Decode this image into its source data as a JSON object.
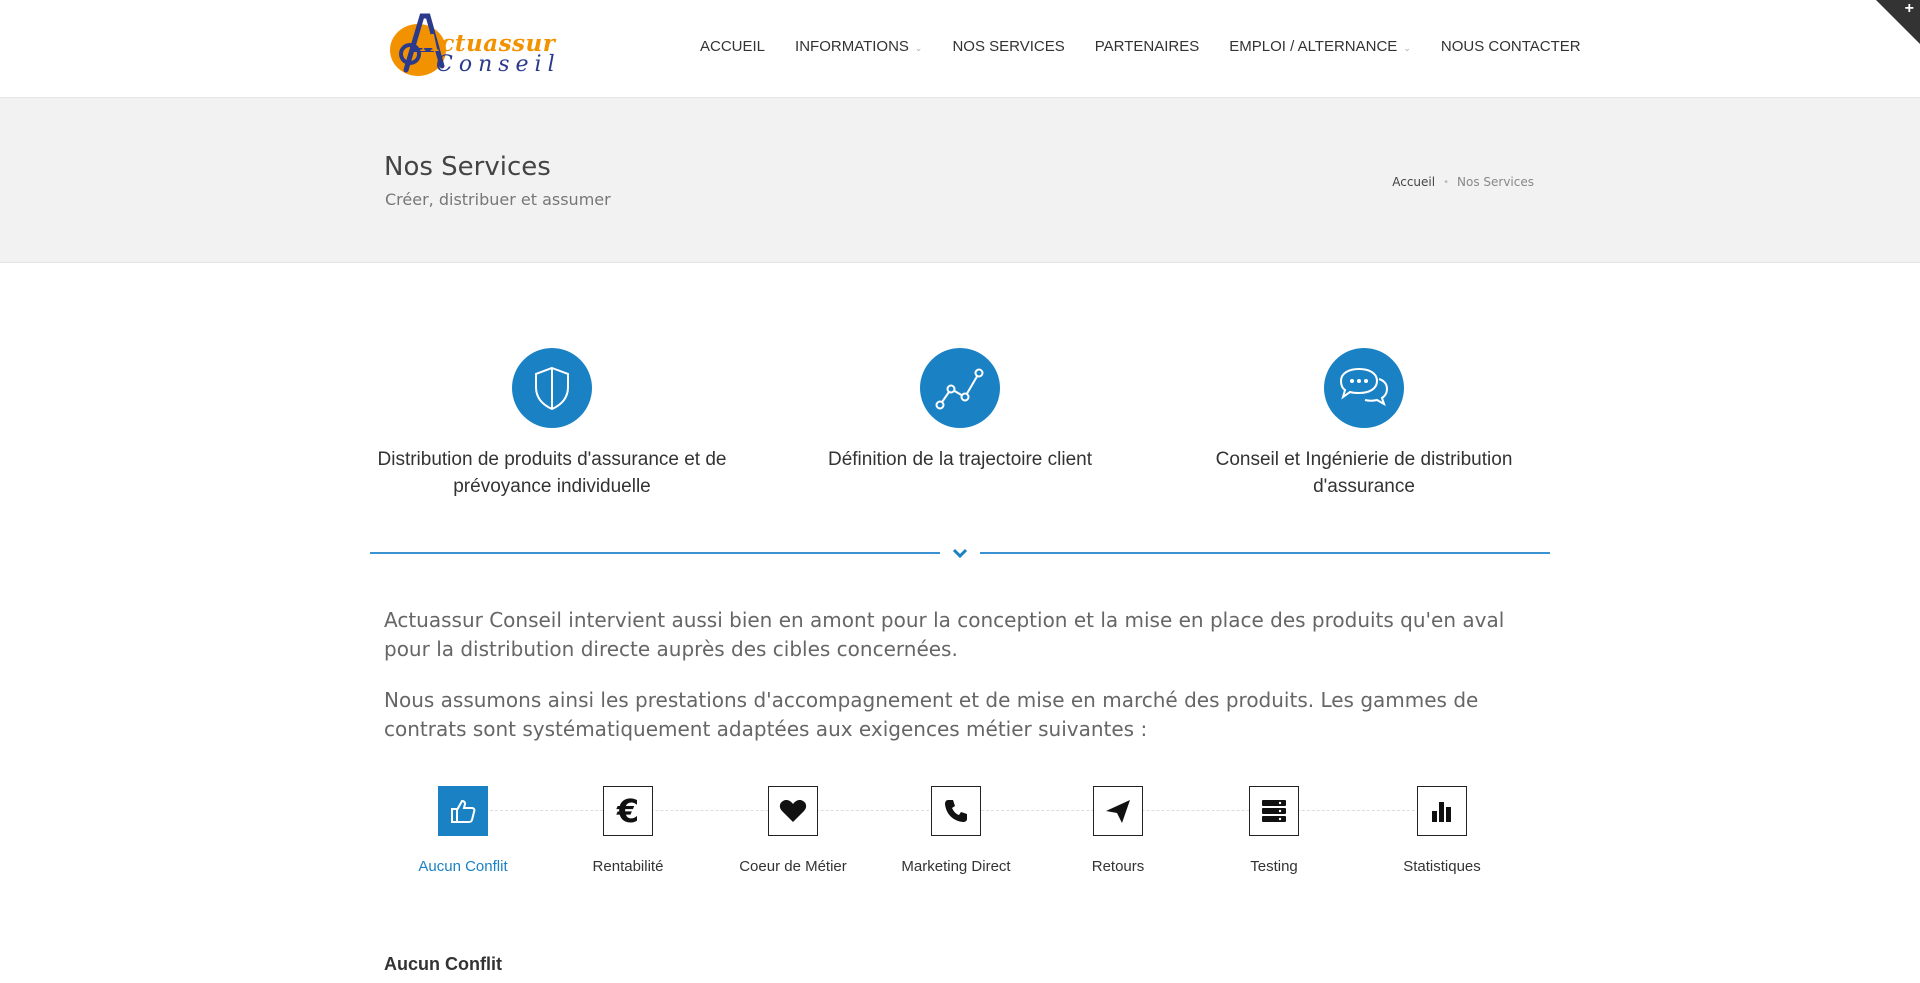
{
  "logo": {
    "line1": "Actuassur",
    "line2": "Conseil"
  },
  "nav": {
    "items": [
      {
        "label": "ACCUEIL",
        "has_dropdown": false
      },
      {
        "label": "INFORMATIONS",
        "has_dropdown": true
      },
      {
        "label": "NOS SERVICES",
        "has_dropdown": false
      },
      {
        "label": "PARTENAIRES",
        "has_dropdown": false
      },
      {
        "label": "EMPLOI / ALTERNANCE",
        "has_dropdown": true
      },
      {
        "label": "NOUS CONTACTER",
        "has_dropdown": false
      }
    ]
  },
  "page_header": {
    "title": "Nos Services",
    "subtitle": "Créer, distribuer et assumer",
    "breadcrumb": {
      "home": "Accueil",
      "current": "Nos Services"
    }
  },
  "features": [
    {
      "icon": "shield-icon",
      "title": "Distribution de produits d'assurance et de prévoyance individuelle"
    },
    {
      "icon": "line-graph-icon",
      "title": "Définition de la trajectoire client"
    },
    {
      "icon": "chat-bubbles-icon",
      "title": "Conseil et Ingénierie de distribution d'assurance"
    }
  ],
  "content": {
    "para1": "Actuassur Conseil intervient aussi bien en amont pour la conception et la mise en place des produits qu'en aval pour la distribution directe auprès des cibles concernées.",
    "para2": "Nous assumons ainsi les prestations d'accompagnement et de mise en marché des produits. Les gammes de contrats sont systématiquement adaptées aux exigences métier suivantes :"
  },
  "process_steps": [
    {
      "label": "Aucun Conflit",
      "icon": "thumbs-up-icon",
      "active": true
    },
    {
      "label": "Rentabilité",
      "icon": "euro-icon",
      "active": false
    },
    {
      "label": "Coeur de Métier",
      "icon": "heart-icon",
      "active": false
    },
    {
      "label": "Marketing Direct",
      "icon": "phone-icon",
      "active": false
    },
    {
      "label": "Retours",
      "icon": "paper-plane-icon",
      "active": false
    },
    {
      "label": "Testing",
      "icon": "server-icon",
      "active": false
    },
    {
      "label": "Statistiques",
      "icon": "bar-chart-icon",
      "active": false
    }
  ],
  "section": {
    "heading": "Aucun Conflit"
  },
  "colors": {
    "accent": "#1a82c4",
    "logo_orange": "#f39200",
    "logo_blue": "#2c3a8c"
  }
}
